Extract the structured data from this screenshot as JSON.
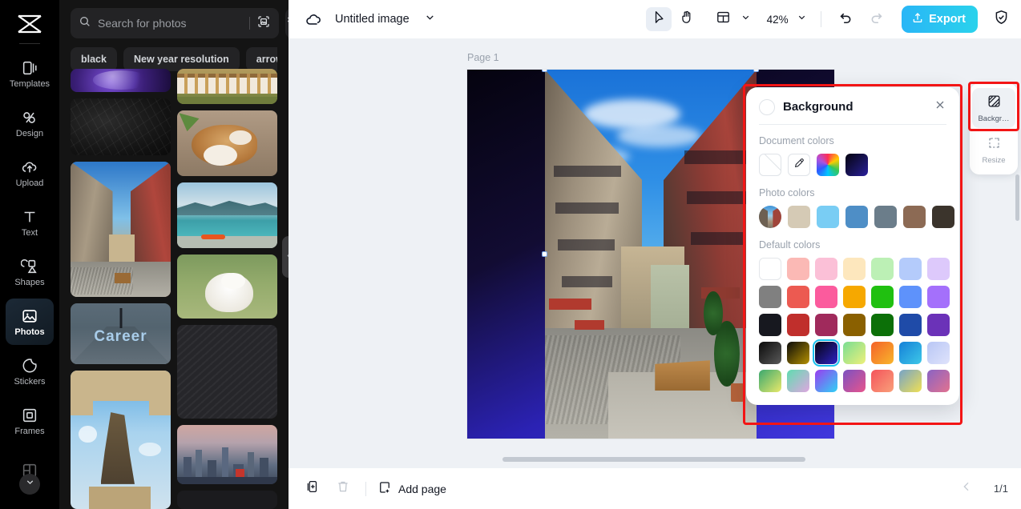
{
  "rail": {
    "logo_icon": "capcut-logo-icon",
    "items": [
      {
        "label": "Templates",
        "icon": "templates-icon",
        "active": false
      },
      {
        "label": "Design",
        "icon": "design-icon",
        "active": false
      },
      {
        "label": "Upload",
        "icon": "upload-cloud-icon",
        "active": false
      },
      {
        "label": "Text",
        "icon": "text-icon",
        "active": false
      },
      {
        "label": "Shapes",
        "icon": "shapes-icon",
        "active": false
      },
      {
        "label": "Photos",
        "icon": "photos-icon",
        "active": true
      },
      {
        "label": "Stickers",
        "icon": "stickers-icon",
        "active": false
      },
      {
        "label": "Frames",
        "icon": "frames-icon",
        "active": false
      }
    ],
    "expand_icon": "chevron-down-icon"
  },
  "photos_panel": {
    "search": {
      "placeholder": "Search for photos",
      "value": "",
      "icon": "search-icon",
      "visual_search_icon": "visual-search-icon"
    },
    "filter_icon": "filter-icon",
    "tags": [
      "black",
      "New year resolution",
      "arrow"
    ],
    "collapse_icon": "chevron-left-icon"
  },
  "topbar": {
    "cloud_icon": "cloud-icon",
    "doc_title": "Untitled image",
    "title_caret_icon": "chevron-down-icon",
    "tools": [
      {
        "name": "select-tool",
        "icon": "cursor-arrow-icon",
        "selected": true
      },
      {
        "name": "hand-tool",
        "icon": "hand-icon",
        "selected": false
      }
    ],
    "layout_icon": "layout-icon",
    "layout_caret_icon": "chevron-down-icon",
    "zoom_level": "42%",
    "zoom_caret_icon": "chevron-down-icon",
    "undo_icon": "undo-icon",
    "redo_icon": "redo-icon",
    "export_label": "Export",
    "export_icon": "export-upload-icon",
    "export_color": "#2ac8ee",
    "shield_icon": "shield-check-icon"
  },
  "canvas": {
    "page_label": "Page 1",
    "page_background_gradient": "#05030f → #4038dd"
  },
  "dock": {
    "items": [
      {
        "label": "Backgr…",
        "icon": "background-icon",
        "active": true,
        "highlighted": true
      },
      {
        "label": "Resize",
        "icon": "resize-icon",
        "active": false,
        "highlighted": false
      }
    ],
    "highlight_color": "#f31515"
  },
  "background_panel": {
    "title": "Background",
    "current_swatch": "#ffffff",
    "close_icon": "close-icon",
    "highlight_color": "#f31515",
    "sections": [
      {
        "label": "Document colors",
        "swatches": [
          {
            "name": "no-color",
            "type": "none",
            "color": ""
          },
          {
            "name": "color-picker",
            "type": "picker",
            "color": "",
            "icon": "eyedropper-icon"
          },
          {
            "name": "rainbow",
            "type": "wheel",
            "color": "rainbow"
          },
          {
            "name": "dark-navy-gradient",
            "type": "gradient",
            "color": "#0d0a2e"
          }
        ]
      },
      {
        "label": "Photo colors",
        "swatches": [
          {
            "name": "source-photo",
            "type": "photo",
            "color": ""
          },
          {
            "name": "beige",
            "type": "solid",
            "color": "#d5cab5"
          },
          {
            "name": "sky-blue",
            "type": "solid",
            "color": "#79cdf4"
          },
          {
            "name": "steel-blue",
            "type": "solid",
            "color": "#4e8ec6"
          },
          {
            "name": "slate-gray",
            "type": "solid",
            "color": "#6b7d8a"
          },
          {
            "name": "brown",
            "type": "solid",
            "color": "#8c6a54"
          },
          {
            "name": "dark-brown",
            "type": "solid",
            "color": "#3b342c"
          }
        ]
      },
      {
        "label": "Default colors",
        "rows": [
          [
            {
              "name": "white",
              "color": "#ffffff"
            },
            {
              "name": "light-salmon",
              "color": "#fbb9b5"
            },
            {
              "name": "light-pink",
              "color": "#fbc0d7"
            },
            {
              "name": "light-peach",
              "color": "#fde7bd"
            },
            {
              "name": "light-green",
              "color": "#bcf0b5"
            },
            {
              "name": "light-blue",
              "color": "#b4cbfb"
            },
            {
              "name": "light-purple",
              "color": "#ddc9fb"
            }
          ],
          [
            {
              "name": "gray",
              "color": "#808080"
            },
            {
              "name": "coral-red",
              "color": "#ec5a51"
            },
            {
              "name": "hot-pink",
              "color": "#fb5b9d"
            },
            {
              "name": "amber",
              "color": "#f6a800"
            },
            {
              "name": "green",
              "color": "#20c010"
            },
            {
              "name": "blue",
              "color": "#5e92fb"
            },
            {
              "name": "purple",
              "color": "#a470fb"
            }
          ],
          [
            {
              "name": "near-black",
              "color": "#17181f"
            },
            {
              "name": "brick-red",
              "color": "#c02f2c"
            },
            {
              "name": "maroon-pink",
              "color": "#a02a5c"
            },
            {
              "name": "dark-gold",
              "color": "#8a6000"
            },
            {
              "name": "dark-green",
              "color": "#0c7008"
            },
            {
              "name": "navy-blue",
              "color": "#1f4ba8"
            },
            {
              "name": "deep-purple",
              "color": "#6b32b8"
            }
          ],
          [
            {
              "name": "black-gray-gradient",
              "color": "linear-gradient(135deg,#0a0a0a 0%,#5a5a5a 100%)"
            },
            {
              "name": "black-gold-gradient",
              "color": "linear-gradient(135deg,#0a0a0a 0%,#b59100 100%)"
            },
            {
              "name": "navy-indigo-gradient",
              "color": "linear-gradient(135deg,#05030f 0%,#2e23c6 100%)",
              "selected": true
            },
            {
              "name": "green-yellow-gradient",
              "color": "linear-gradient(135deg,#79dd93 0%,#eef07a 100%)"
            },
            {
              "name": "orange-yellow-gradient",
              "color": "linear-gradient(135deg,#f4622a 0%,#f8b62b 100%)"
            },
            {
              "name": "blue-cyan-gradient",
              "color": "linear-gradient(135deg,#1480d8 0%,#3ec8e8 100%)"
            },
            {
              "name": "lavender-gradient",
              "color": "linear-gradient(135deg,#b8c6f5 0%,#dfe3fb 100%)"
            }
          ],
          [
            {
              "name": "green-yellow-2-gradient",
              "color": "linear-gradient(135deg,#3aa86f 0%,#e9e96a 100%)"
            },
            {
              "name": "mint-pink-gradient",
              "color": "linear-gradient(135deg,#5fdcb0 0%,#dfa6e0 100%)"
            },
            {
              "name": "purple-cyan-gradient",
              "color": "linear-gradient(135deg,#9a3cf0 0%,#2fd2f5 100%)"
            },
            {
              "name": "purple-pink-gradient",
              "color": "linear-gradient(135deg,#7b52c2 0%,#e8548c 100%)"
            },
            {
              "name": "red-pink-gradient",
              "color": "linear-gradient(135deg,#f4545b 0%,#f9a07a 100%)"
            },
            {
              "name": "blue-yellow-gradient",
              "color": "linear-gradient(135deg,#76a3c8 0%,#f0e054 100%)"
            },
            {
              "name": "purple-rose-gradient",
              "color": "linear-gradient(135deg,#8a63c4 0%,#e2728f 100%)"
            }
          ]
        ]
      }
    ]
  },
  "bottombar": {
    "duplicate_icon": "duplicate-page-icon",
    "delete_icon": "trash-icon",
    "add_page_label": "Add page",
    "add_page_icon": "add-page-icon",
    "prev_icon": "chevron-left-icon",
    "page_count": "1/1"
  }
}
